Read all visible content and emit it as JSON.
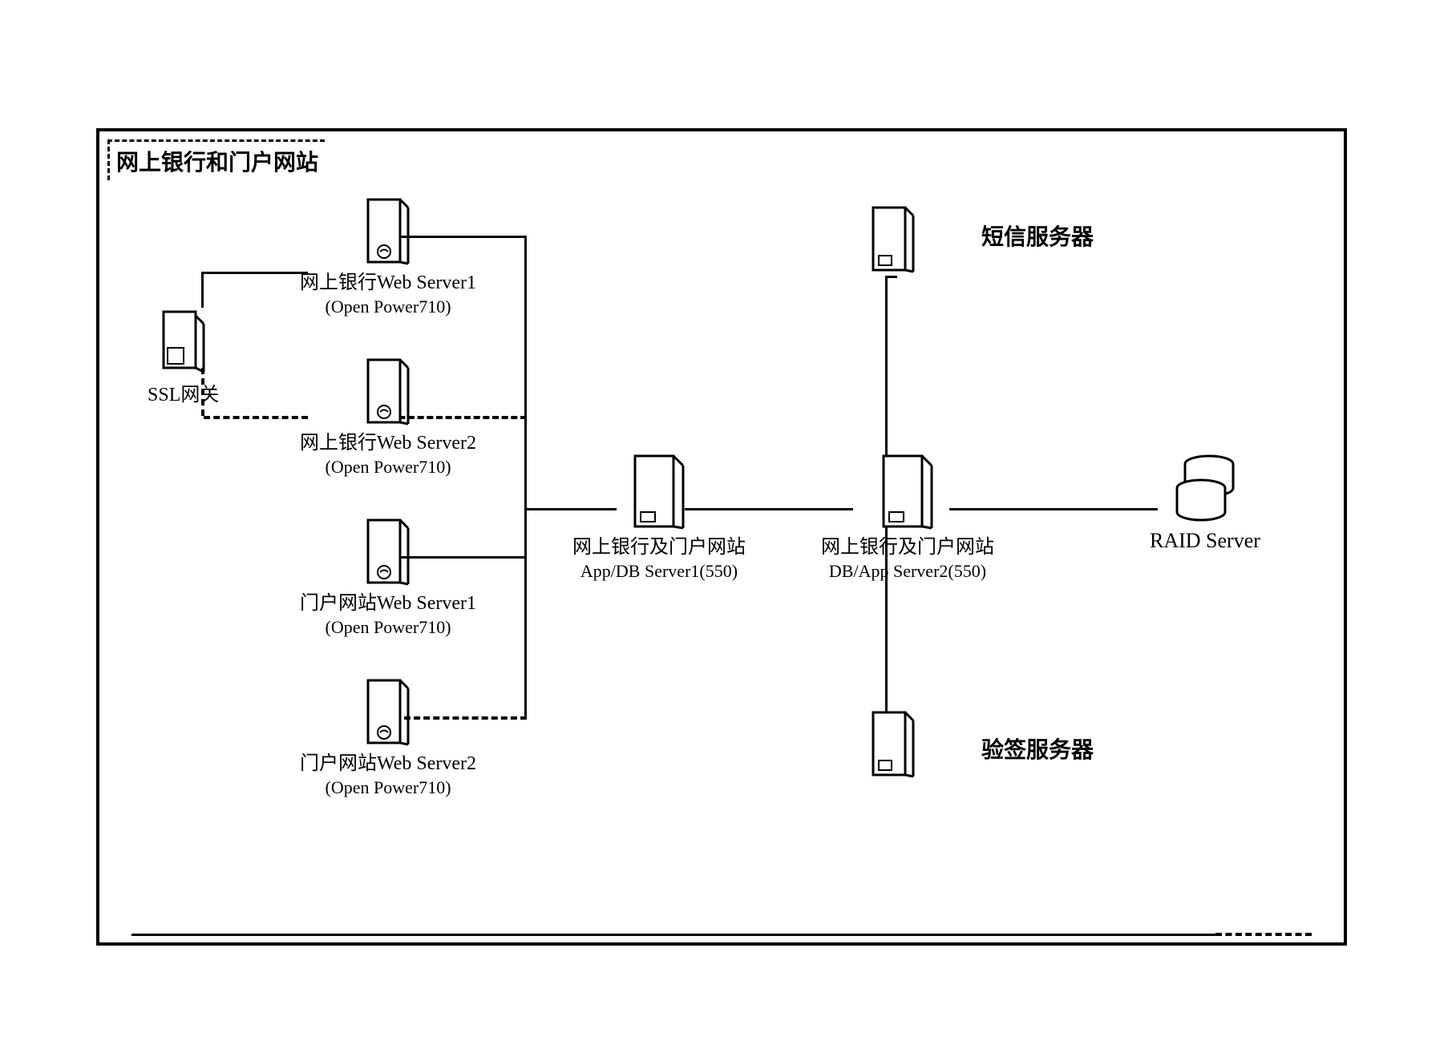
{
  "title": "网上银行和门户网站",
  "nodes": {
    "ssl_gateway": {
      "label": "SSL网关"
    },
    "web1": {
      "label": "网上银行Web Server1",
      "sub": "(Open Power710)"
    },
    "web2": {
      "label": "网上银行Web Server2",
      "sub": "(Open Power710)"
    },
    "portal1": {
      "label": "门户网站Web Server1",
      "sub": "(Open Power710)"
    },
    "portal2": {
      "label": "门户网站Web Server2",
      "sub": "(Open Power710)"
    },
    "appdb1": {
      "label": "网上银行及门户网站",
      "sub": "App/DB Server1(550)"
    },
    "appdb2": {
      "label": "网上银行及门户网站",
      "sub": "DB/App Server2(550)"
    },
    "sms": {
      "label": "短信服务器"
    },
    "verify": {
      "label": "验签服务器"
    },
    "raid": {
      "label": "RAID Server"
    }
  }
}
